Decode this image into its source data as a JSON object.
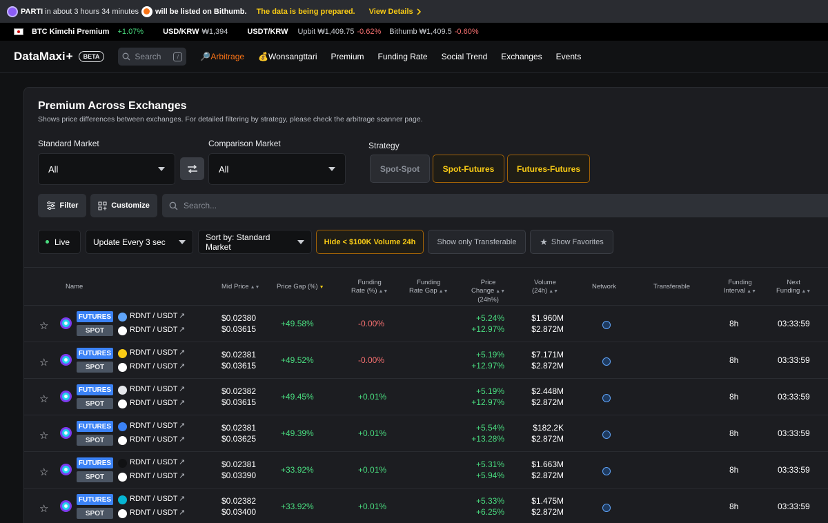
{
  "announcement": {
    "coin": "PARTI",
    "text": "in about 3 hours 34 minutes",
    "listed": "will be listed on Bithumb.",
    "preparing": "The data is being prepared.",
    "view_details": "View Details"
  },
  "ticker": {
    "kimchi_label": "BTC Kimchi Premium",
    "kimchi_value": "+1.07%",
    "usdkrw_label": "USD/KRW",
    "usdkrw_value": "₩1,394",
    "usdtkrw_label": "USDT/KRW",
    "upbit": "Upbit ₩1,409.75",
    "upbit_change": "-0.62%",
    "bithumb": "Bithumb ₩1,409.5",
    "bithumb_change": "-0.60%"
  },
  "nav": {
    "logo": "DataMaxi",
    "logo_plus": "+",
    "beta": "BETA",
    "search_placeholder": "Search",
    "search_shortcut": "/",
    "links": [
      "🔎Arbitrage",
      "💰Wonsangttari",
      "Premium",
      "Funding Rate",
      "Social Trend",
      "Exchanges",
      "Events"
    ]
  },
  "panel": {
    "title": "Premium Across Exchanges",
    "subtitle": "Shows price differences between exchanges. For detailed filtering by strategy, please check the arbitrage scanner page.",
    "standard_market_label": "Standard Market",
    "standard_market_value": "All",
    "comparison_market_label": "Comparison Market",
    "comparison_market_value": "All",
    "strategy_label": "Strategy",
    "strategies": [
      "Spot-Spot",
      "Spot-Futures",
      "Futures-Futures"
    ],
    "filter": "Filter",
    "customize": "Customize",
    "search_placeholder": "Search...",
    "live": "Live",
    "update": "Update Every 3 sec",
    "sort": "Sort by: Standard Market",
    "hide_volume": "Hide < $100K Volume 24h",
    "show_transferable": "Show only Transferable",
    "show_favorites": "Show Favorites"
  },
  "table": {
    "headers": {
      "name": "Name",
      "mid_price": "Mid Price",
      "price_gap": "Price Gap (%)",
      "funding_rate_1": "Funding",
      "funding_rate_2": "Rate (%)",
      "funding_gap_1": "Funding",
      "funding_gap_2": "Rate Gap",
      "price_change_1": "Price",
      "price_change_2": "Change",
      "price_change_3": "(24h%)",
      "volume_1": "Volume",
      "volume_2": "(24h)",
      "network": "Network",
      "transferable": "Transferable",
      "interval_1": "Funding",
      "interval_2": "Interval",
      "next_1": "Next",
      "next_2": "Funding"
    },
    "rows": [
      {
        "fut": "FUTURES",
        "spot": "SPOT",
        "pair1": "RDNT / USDT",
        "pair2": "RDNT / USDT",
        "price1": "$0.02380",
        "price2": "$0.03615",
        "gap": "+49.58%",
        "funding": "-0.00%",
        "chg1": "+5.24%",
        "chg2": "+12.97%",
        "vol1": "$1.960M",
        "vol2": "$2.872M",
        "interval": "8h",
        "next": "03:33:59",
        "ex_color": "#60a5fa"
      },
      {
        "fut": "FUTURES",
        "spot": "SPOT",
        "pair1": "RDNT / USDT",
        "pair2": "RDNT / USDT",
        "price1": "$0.02381",
        "price2": "$0.03615",
        "gap": "+49.52%",
        "funding": "-0.00%",
        "chg1": "+5.19%",
        "chg2": "+12.97%",
        "vol1": "$7.171M",
        "vol2": "$2.872M",
        "interval": "8h",
        "next": "03:33:59",
        "ex_color": "#facc15"
      },
      {
        "fut": "FUTURES",
        "spot": "SPOT",
        "pair1": "RDNT / USDT",
        "pair2": "RDNT / USDT",
        "price1": "$0.02382",
        "price2": "$0.03615",
        "gap": "+49.45%",
        "funding": "+0.01%",
        "chg1": "+5.19%",
        "chg2": "+12.97%",
        "vol1": "$2.448M",
        "vol2": "$2.872M",
        "interval": "8h",
        "next": "03:33:59",
        "ex_color": "#e5e7eb"
      },
      {
        "fut": "FUTURES",
        "spot": "SPOT",
        "pair1": "RDNT / USDT",
        "pair2": "RDNT / USDT",
        "price1": "$0.02381",
        "price2": "$0.03625",
        "gap": "+49.39%",
        "funding": "+0.01%",
        "chg1": "+5.54%",
        "chg2": "+13.28%",
        "vol1": "$182.2K",
        "vol2": "$2.872M",
        "interval": "8h",
        "next": "03:33:59",
        "ex_color": "#3b82f6"
      },
      {
        "fut": "FUTURES",
        "spot": "SPOT",
        "pair1": "RDNT / USDT",
        "pair2": "RDNT / USDT",
        "price1": "$0.02381",
        "price2": "$0.03390",
        "gap": "+33.92%",
        "funding": "+0.01%",
        "chg1": "+5.31%",
        "chg2": "+5.94%",
        "vol1": "$1.663M",
        "vol2": "$2.872M",
        "interval": "8h",
        "next": "03:33:59",
        "ex_color": "#111214"
      },
      {
        "fut": "FUTURES",
        "spot": "SPOT",
        "pair1": "RDNT / USDT",
        "pair2": "RDNT / USDT",
        "price1": "$0.02382",
        "price2": "$0.03400",
        "gap": "+33.92%",
        "funding": "+0.01%",
        "chg1": "+5.33%",
        "chg2": "+6.25%",
        "vol1": "$1.475M",
        "vol2": "$2.872M",
        "interval": "8h",
        "next": "03:33:59",
        "ex_color": "#06b6d4"
      }
    ]
  }
}
